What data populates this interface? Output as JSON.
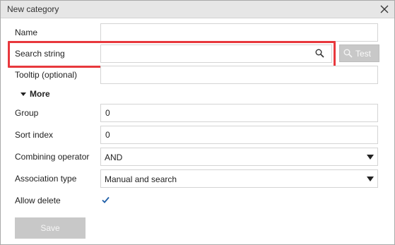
{
  "window": {
    "title": "New category"
  },
  "form": {
    "name_label": "Name",
    "name_value": "",
    "search_label": "Search string",
    "search_value": "",
    "test_label": "Test",
    "tooltip_label": "Tooltip (optional)",
    "tooltip_value": "",
    "more_label": "More",
    "group_label": "Group",
    "group_value": "0",
    "sort_label": "Sort index",
    "sort_value": "0",
    "combining_label": "Combining operator",
    "combining_value": "AND",
    "association_label": "Association type",
    "association_value": "Manual and search",
    "allow_delete_label": "Allow delete",
    "allow_delete_checked": true,
    "save_label": "Save"
  },
  "colors": {
    "highlight": "#e8383d",
    "accent": "#1f5fa8",
    "disabled_button": "#c8c8c8"
  },
  "icons": [
    "close-icon",
    "search-icon",
    "magnifier-icon",
    "triangle-down-icon",
    "chevron-down-icon",
    "checkmark-icon"
  ]
}
